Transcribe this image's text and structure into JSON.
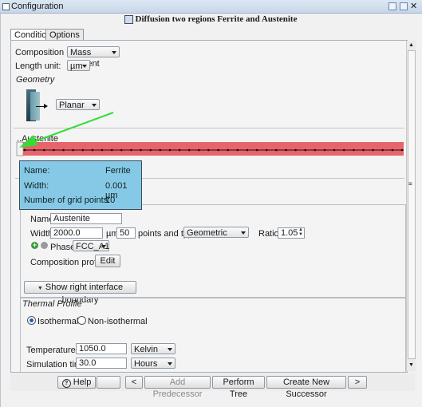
{
  "window": {
    "title": "Configuration"
  },
  "header": {
    "title": "Diffusion two regions Ferrite and Austenite"
  },
  "tabs": [
    {
      "label": "Conditions"
    },
    {
      "label": "Options"
    }
  ],
  "composition": {
    "label": "Composition unit:",
    "value": "Mass percent"
  },
  "length": {
    "label": "Length unit:",
    "value": "µm"
  },
  "geometry": {
    "heading": "Geometry",
    "value": "Planar"
  },
  "austenite_label": "..Austenite",
  "grid": {
    "marker_count": 40,
    "bar_color": "#e9646a",
    "line_color": "#111111"
  },
  "tooltip": {
    "name_label": "Name:",
    "name_value": "Ferrite",
    "width_label": "Width:",
    "width_value": "0.001 µm",
    "points_label": "Number of grid points:",
    "points_value": "10"
  },
  "region": {
    "name_label": "Name:",
    "name_value": "Austenite",
    "width_label": "Width:",
    "width_value": "2000.0",
    "width_unit": "µm",
    "points_value": "50",
    "points_and_type_label": "points and type",
    "type_value": "Geometric",
    "ratio_label": "Ratio:",
    "ratio_value": "1.05",
    "phase_label": "Phase:",
    "phase_value": "FCC_A1",
    "composition_profiles_label": "Composition profiles:",
    "edit_label": "Edit",
    "interface_button": "Show right interface boundary"
  },
  "thermal": {
    "heading": "Thermal Profile",
    "isothermal": "Isothermal",
    "nonisothermal": "Non-isothermal",
    "temperature_label": "Temperature:",
    "temperature_value": "1050.0",
    "temperature_unit": "Kelvin",
    "simtime_label": "Simulation time:",
    "simtime_value": "30.0",
    "simtime_unit": "Hours"
  },
  "bottom": {
    "help": "Help",
    "prev": "<",
    "add_predecessor": "Add Predecessor",
    "perform_tree": "Perform Tree",
    "create_successor": "Create New Successor",
    "next": ">"
  },
  "colors": {
    "accent_tooltip": "#86c9e6",
    "arrow": "#33dd33",
    "radio_on": "#1f5fbf"
  }
}
